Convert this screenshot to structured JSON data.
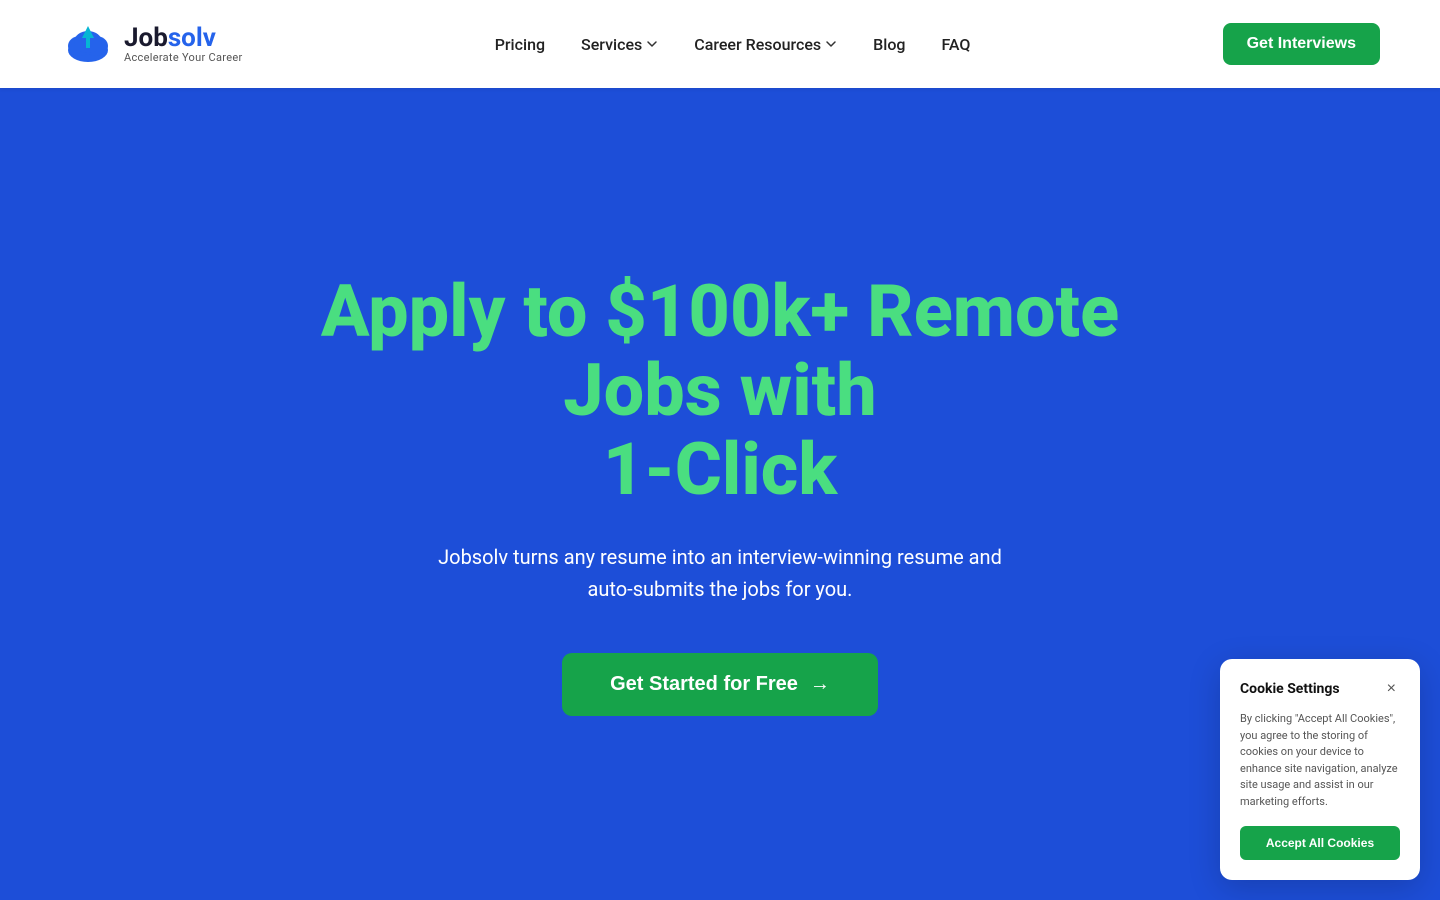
{
  "logo": {
    "name_job": "Job",
    "name_solv": "solv",
    "tagline": "Accelerate Your Career",
    "icon_alt": "jobsolv-logo"
  },
  "navbar": {
    "links": [
      {
        "label": "Pricing",
        "has_dropdown": false
      },
      {
        "label": "Services",
        "has_dropdown": true
      },
      {
        "label": "Career Resources",
        "has_dropdown": true
      },
      {
        "label": "Blog",
        "has_dropdown": false
      },
      {
        "label": "FAQ",
        "has_dropdown": false
      }
    ],
    "cta_label": "Get Interviews"
  },
  "hero": {
    "title_line1": "Apply to $100k+ Remote Jobs with",
    "title_line2": "1-Click",
    "subtitle": "Jobsolv turns any resume into an interview-winning resume and auto-submits the jobs for you.",
    "cta_label": "Get Started for Free"
  },
  "cookie": {
    "title": "Cookie Settings",
    "body": "By clicking \"Accept All Cookies\", you agree to the storing of cookies on your device to enhance site navigation, analyze site usage and assist in our marketing efforts.",
    "accept_label": "Accept All Cookies",
    "close_label": "×"
  }
}
